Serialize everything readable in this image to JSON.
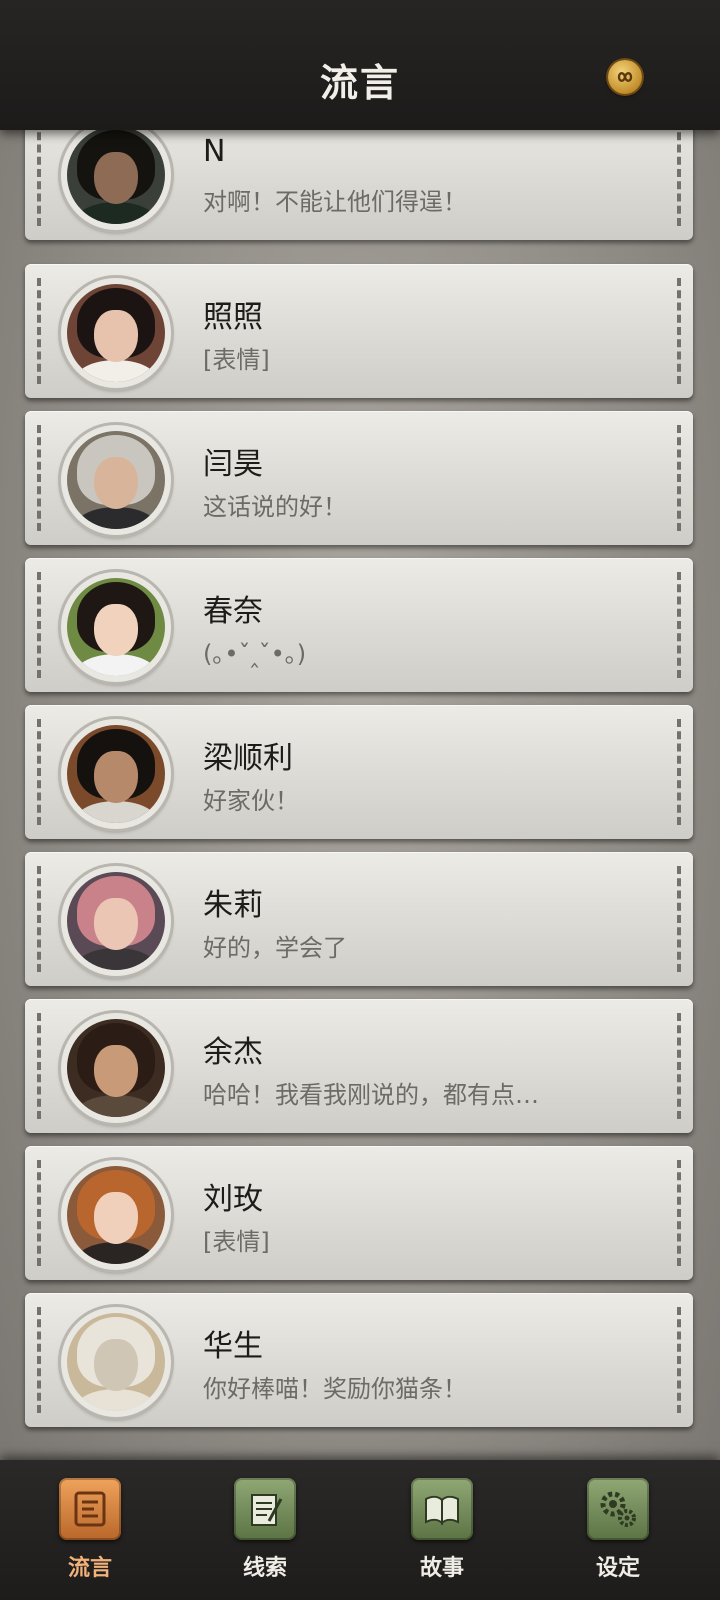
{
  "header": {
    "title": "流言"
  },
  "conversations": [
    {
      "name": "N",
      "message": "对啊！不能让他们得逞！",
      "colors": {
        "bg": "#3b3f3a",
        "hair": "#15130f",
        "face": "#8d6b55",
        "body": "#1d2a22"
      }
    },
    {
      "name": "照照",
      "message": "[表情]",
      "colors": {
        "bg": "#6d4436",
        "hair": "#1b1412",
        "face": "#e7c3ad",
        "body": "#f2efe9"
      }
    },
    {
      "name": "闫昊",
      "message": "这话说的好！",
      "colors": {
        "bg": "#7a7366",
        "hair": "#c9c6bf",
        "face": "#d8b59a",
        "body": "#2b2b2e"
      }
    },
    {
      "name": "春奈",
      "message": "(｡•ˇ‸ˇ•｡)",
      "colors": {
        "bg": "#6f8a42",
        "hair": "#1e1714",
        "face": "#f0d2bd",
        "body": "#f3f3f3"
      }
    },
    {
      "name": "梁顺利",
      "message": "好家伙！",
      "colors": {
        "bg": "#7a4a2a",
        "hair": "#15110e",
        "face": "#b7896b",
        "body": "#d9d6d0"
      }
    },
    {
      "name": "朱莉",
      "message": "好的，学会了",
      "colors": {
        "bg": "#5a4a55",
        "hair": "#c9828a",
        "face": "#ebc6b4",
        "body": "#3a3538"
      }
    },
    {
      "name": "余杰",
      "message": "哈哈！我看我刚说的，都有点…",
      "colors": {
        "bg": "#3c2c22",
        "hair": "#2b1d15",
        "face": "#c99a78",
        "body": "#5a4a3c"
      }
    },
    {
      "name": "刘玫",
      "message": "[表情]",
      "colors": {
        "bg": "#8a5a3a",
        "hair": "#b8662e",
        "face": "#f1d0bb",
        "body": "#2a2523"
      }
    },
    {
      "name": "华生",
      "message": "你好棒喵！奖励你猫条！",
      "colors": {
        "bg": "#c9b899",
        "hair": "#e9e4da",
        "face": "#cfc6b6",
        "body": "#e8e2d6"
      }
    }
  ],
  "nav": [
    {
      "label": "流言",
      "icon": "chat-icon",
      "active": true
    },
    {
      "label": "线索",
      "icon": "notepad-icon",
      "active": false
    },
    {
      "label": "故事",
      "icon": "book-icon",
      "active": false
    },
    {
      "label": "设定",
      "icon": "gears-icon",
      "active": false
    }
  ]
}
